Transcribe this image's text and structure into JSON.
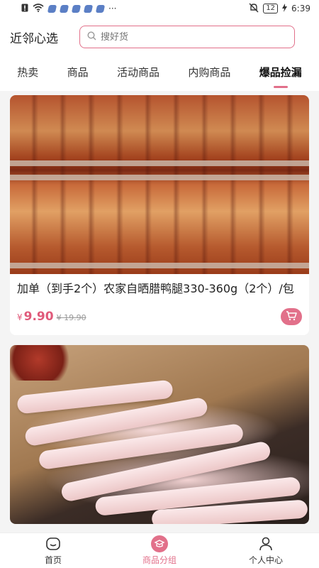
{
  "status_bar": {
    "time": "6:39",
    "battery": "12",
    "extra": "···"
  },
  "header": {
    "title": "近邻心选",
    "search_placeholder": "搜好货"
  },
  "tabs": [
    {
      "label": "热卖",
      "active": false
    },
    {
      "label": "商品",
      "active": false
    },
    {
      "label": "活动商品",
      "active": false
    },
    {
      "label": "内购商品",
      "active": false
    },
    {
      "label": "爆品捡漏",
      "active": true
    }
  ],
  "products": [
    {
      "title": "加单（到手2个）农家自晒腊鸭腿330-360g（2个）/包",
      "currency": "¥",
      "price": "9.90",
      "original_price": "¥ 19.90"
    },
    {
      "title": "",
      "currency": "",
      "price": "",
      "original_price": ""
    }
  ],
  "bottom_nav": [
    {
      "label": "首页",
      "icon": "home-icon",
      "active": false
    },
    {
      "label": "商品分组",
      "icon": "category-icon",
      "active": true
    },
    {
      "label": "个人中心",
      "icon": "profile-icon",
      "active": false
    }
  ],
  "colors": {
    "accent": "#e2708a",
    "price": "#e05a7a",
    "background": "#f4f4f4"
  }
}
